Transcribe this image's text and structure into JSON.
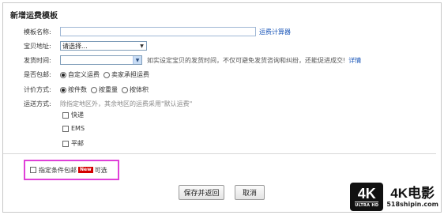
{
  "title": "新增运费模板",
  "template_name": {
    "label": "模板名称:",
    "value": "",
    "link": "运费计算器"
  },
  "location": {
    "label": "宝贝地址:",
    "selected": "请选择..."
  },
  "ship_time": {
    "label": "发货时间:",
    "selected": "",
    "hint": "如实设定宝贝的发货时间，不仅可避免发货咨询和纠纷，还能促进成交!",
    "hint_link": "详情"
  },
  "free_shipping": {
    "label": "是否包邮:",
    "options": [
      "自定义运费",
      "卖家承担运费"
    ],
    "selected": 0
  },
  "pricing": {
    "label": "计价方式:",
    "options": [
      "按件数",
      "按重量",
      "按体积"
    ],
    "selected": 0
  },
  "delivery": {
    "label": "运送方式:",
    "hint": "除指定地区外，其余地区的运费采用\"默认运费\"",
    "methods": [
      "快递",
      "EMS",
      "平邮"
    ]
  },
  "conditional_free": {
    "label": "指定条件包邮",
    "badge": "New",
    "suffix": "可选"
  },
  "buttons": {
    "save": "保存并返回",
    "cancel": "取消"
  },
  "watermark": {
    "badge": "4K",
    "badge_sub": "ULTRA HD",
    "brand": "4K电影",
    "site": "518shipin.com"
  }
}
